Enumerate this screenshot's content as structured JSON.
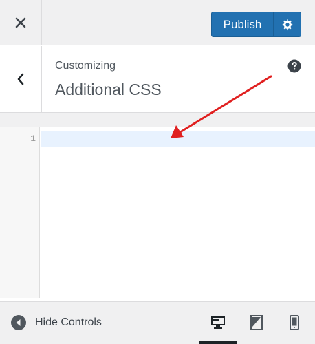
{
  "header": {
    "close_icon": "close-icon",
    "publish_label": "Publish",
    "settings_icon": "gear-icon"
  },
  "section": {
    "back_icon": "chevron-left-icon",
    "crumb": "Customizing",
    "title": "Additional CSS",
    "help_icon": "help-icon"
  },
  "editor": {
    "line_numbers": [
      "1"
    ]
  },
  "footer": {
    "hide_label": "Hide Controls",
    "devices": [
      "desktop-icon",
      "tablet-icon",
      "mobile-icon"
    ],
    "active_device": "desktop"
  },
  "colors": {
    "primary": "#2271b1",
    "active_line": "#e8f2fe",
    "annotation_arrow": "#e02020"
  }
}
